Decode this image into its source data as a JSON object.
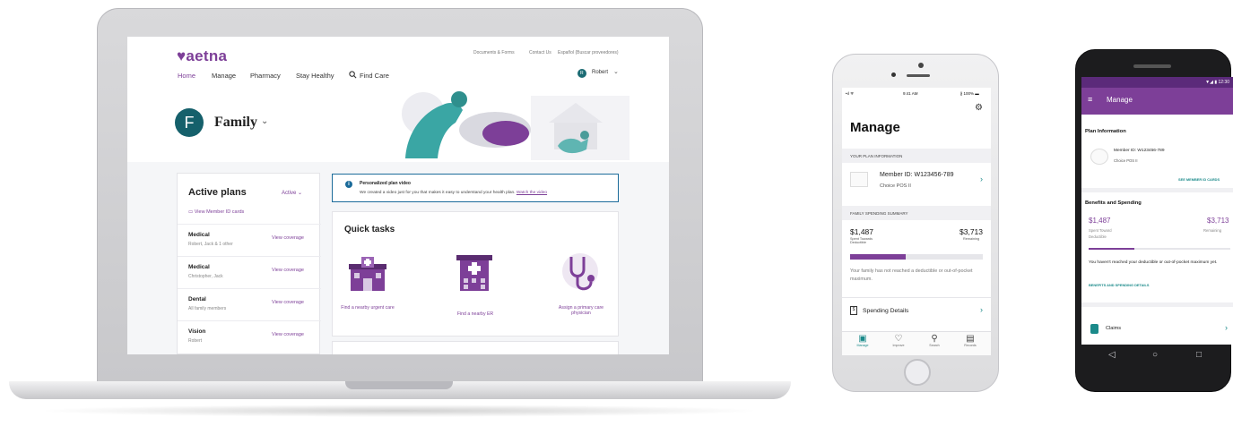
{
  "web": {
    "logo": "♥aetna",
    "util_links": [
      "Documents & Forms",
      "Contact Us",
      "Español (Buscar proveedores)"
    ],
    "nav": [
      "Home",
      "Manage",
      "Pharmacy",
      "Stay Healthy",
      "Find Care"
    ],
    "user": {
      "initial": "R",
      "name": "Robert"
    },
    "profile": {
      "initial": "F",
      "name": "Family"
    },
    "plans": {
      "title": "Active plans",
      "filter": "Active",
      "id_cards_link": "View Member ID cards",
      "rows": [
        {
          "name": "Medical",
          "members": "Robert, Jack & 1 other",
          "link": "View coverage"
        },
        {
          "name": "Medical",
          "members": "Christopher, Jack",
          "link": "View coverage"
        },
        {
          "name": "Dental",
          "members": "All family members",
          "link": "View coverage"
        },
        {
          "name": "Vision",
          "members": "Robert",
          "link": "View coverage"
        }
      ]
    },
    "video": {
      "title": "Personalized plan video",
      "text": "We created a video just for you that makes it easy to understand your health plan.",
      "link": "Watch the video"
    },
    "quick_tasks": {
      "title": "Quick tasks",
      "items": [
        "Find a nearby urgent care",
        "Find a nearby ER",
        "Assign a primary care physician"
      ]
    }
  },
  "iphone": {
    "status": {
      "signal": "•ıl ᯤ",
      "time": "9:41 AM",
      "battery": "∦ 100% ▬"
    },
    "title": "Manage",
    "plan_section": "YOUR PLAN INFORMATION",
    "member_id": "Member ID: W123456-789",
    "plan_name": "Choice POS II",
    "spending_section": "FAMILY SPENDING SUMMARY",
    "spent_amount": "$1,487",
    "spent_label": "Spent Towards Deductible",
    "remaining_amount": "$3,713",
    "remaining_label": "Remaining",
    "progress_fraction": 0.42,
    "note": "Your family has not reached a deductible or out-of-pocket maximum.",
    "spending_details": "Spending Details",
    "tabs": [
      "Manage",
      "Improve",
      "Search",
      "Records"
    ]
  },
  "android": {
    "status": "▼◢ ▮ 12:30",
    "title": "Manage",
    "plan_heading": "Plan Information",
    "member_id": "Member ID: W123456-789",
    "plan_name": "Choice POS II",
    "id_cards_link": "SEE MEMBER ID CARDS",
    "benefits_heading": "Benefits and Spending",
    "spent_amount": "$1,487",
    "spent_label": "Spent Toward Deductible",
    "remaining_amount": "$3,713",
    "remaining_label": "Remaining",
    "progress_fraction": 0.32,
    "note": "You haven't reached your deductible or out-of-pocket maximum yet.",
    "details_link": "BENEFITS AND SPENDING DETAILS",
    "claims": "Claims"
  },
  "colors": {
    "brand": "#7d3f98",
    "teal": "#1b8a8a",
    "dark_teal": "#15606b"
  }
}
